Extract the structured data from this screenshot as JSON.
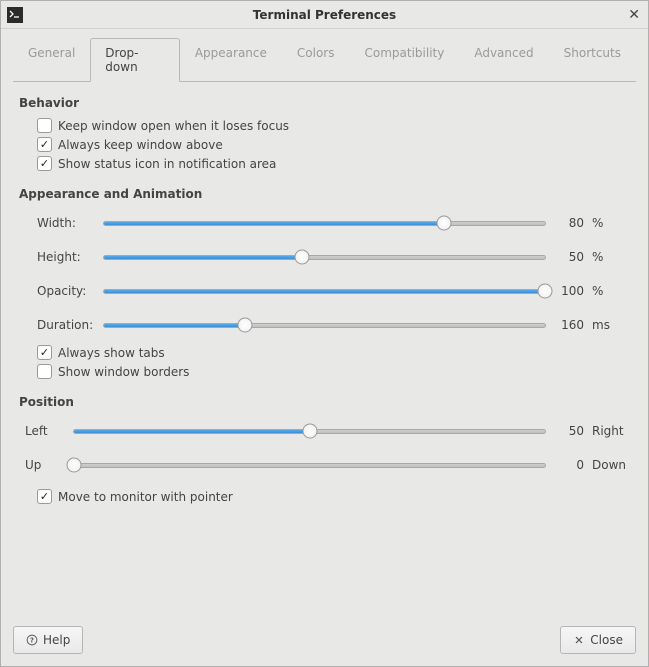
{
  "window": {
    "title": "Terminal Preferences"
  },
  "tabs": {
    "general": "General",
    "dropdown": "Drop-down",
    "appearance": "Appearance",
    "colors": "Colors",
    "compatibility": "Compatibility",
    "advanced": "Advanced",
    "shortcuts": "Shortcuts",
    "active": "dropdown"
  },
  "behavior": {
    "title": "Behavior",
    "keep_open_label": "Keep window open when it loses focus",
    "keep_open_checked": false,
    "always_above_label": "Always keep window above",
    "always_above_checked": true,
    "status_icon_label": "Show status icon in notification area",
    "status_icon_checked": true
  },
  "appearance_anim": {
    "title": "Appearance and Animation",
    "width_label": "Width:",
    "width_value": 80,
    "width_unit": "%",
    "height_label": "Height:",
    "height_value": 50,
    "height_unit": "%",
    "opacity_label": "Opacity:",
    "opacity_value": 100,
    "opacity_unit": "%",
    "duration_label": "Duration:",
    "duration_value": 160,
    "duration_unit": "ms",
    "always_show_tabs_label": "Always show tabs",
    "always_show_tabs_checked": true,
    "show_borders_label": "Show window borders",
    "show_borders_checked": false
  },
  "position": {
    "title": "Position",
    "left_label": "Left",
    "right_label": "Right",
    "horiz_value": 50,
    "up_label": "Up",
    "down_label": "Down",
    "vert_value": 0,
    "move_pointer_label": "Move to monitor with pointer",
    "move_pointer_checked": true
  },
  "footer": {
    "help_label": "Help",
    "close_label": "Close"
  },
  "slider_percents": {
    "width": 77,
    "height": 45,
    "opacity": 100,
    "duration": 32,
    "horiz": 50,
    "vert": 0
  }
}
